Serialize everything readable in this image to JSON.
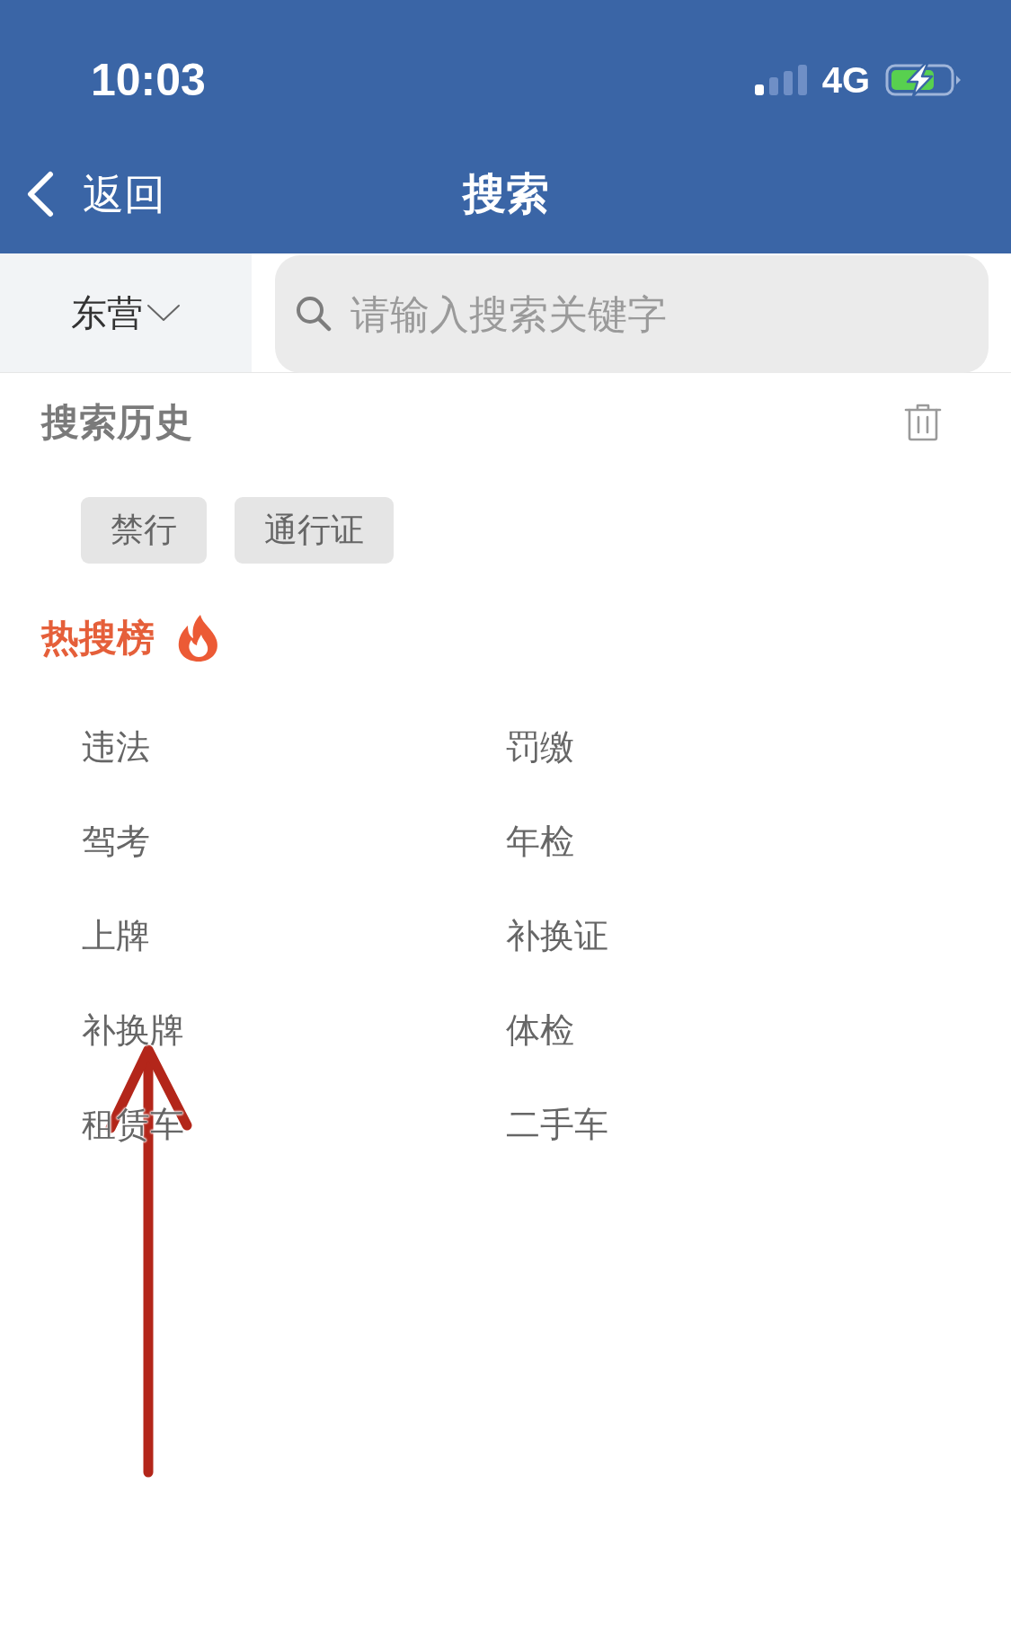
{
  "status_bar": {
    "time": "10:03",
    "network": "4G",
    "charging": true
  },
  "nav_bar": {
    "back_label": "返回",
    "title": "搜索"
  },
  "search_bar": {
    "city": "东营",
    "placeholder": "请输入搜索关键字"
  },
  "history": {
    "title": "搜索历史",
    "tags": [
      "禁行",
      "通行证"
    ]
  },
  "hot": {
    "title": "热搜榜",
    "items": [
      "违法",
      "罚缴",
      "驾考",
      "年检",
      "上牌",
      "补换证",
      "补换牌",
      "体检",
      "租赁车",
      "二手车"
    ]
  },
  "annotations": [
    {
      "kind": "arrow"
    }
  ]
}
